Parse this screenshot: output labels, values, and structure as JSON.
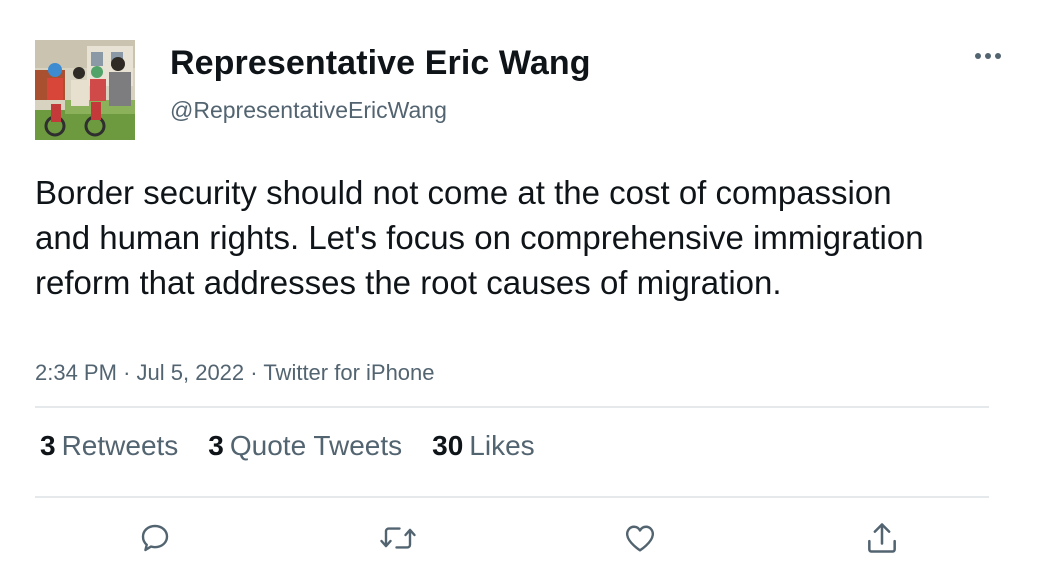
{
  "author": {
    "name": "Representative Eric Wang",
    "handle": "@RepresentativeEricWang"
  },
  "tweet": {
    "text": "Border security should not come at the cost of compassion and human rights. Let's focus on comprehensive immigration reform that addresses the root causes of migration.",
    "time": "2:34 PM",
    "date": "Jul 5, 2022",
    "source": "Twitter for iPhone",
    "separator": "·"
  },
  "stats": {
    "retweets": {
      "count": "3",
      "label": "Retweets"
    },
    "quote_tweets": {
      "count": "3",
      "label": "Quote Tweets"
    },
    "likes": {
      "count": "30",
      "label": "Likes"
    }
  },
  "actions": [
    "reply-icon",
    "retweet-icon",
    "like-icon",
    "share-icon"
  ],
  "colors": {
    "text_primary": "#0f1419",
    "text_secondary": "#536471",
    "divider": "#e6e9eb",
    "icon": "#536471"
  }
}
